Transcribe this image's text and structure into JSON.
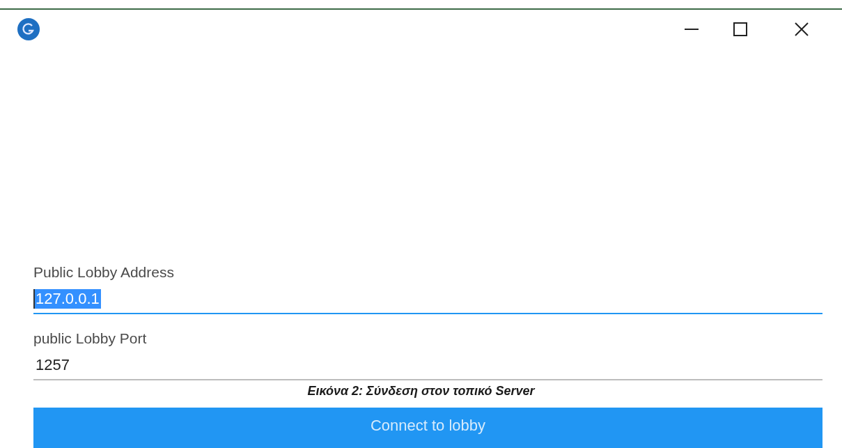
{
  "window": {
    "controls": [
      {
        "kind": "minimize"
      },
      {
        "kind": "maximize"
      },
      {
        "kind": "close"
      }
    ]
  },
  "fields": [
    {
      "label": "Public Lobby Address",
      "value": "127.0.0.1",
      "focused": true,
      "text_selected": true
    },
    {
      "label": "public Lobby Port",
      "value": "1257",
      "focused": false,
      "text_selected": false
    }
  ],
  "caption": "Εικόνα 2: Σύνδεση στον τοπικό Server",
  "button": {
    "label": "Connect to lobby"
  }
}
